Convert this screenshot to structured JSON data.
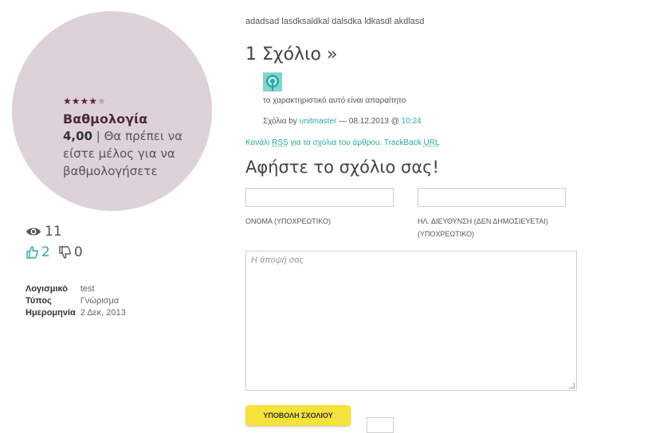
{
  "colors": {
    "accent": "#2aa8a0",
    "circle": "#ddd2d8",
    "button": "#f5e23a",
    "star": "#5e1f49"
  },
  "rating": {
    "stars_filled": 4,
    "stars_total": 5,
    "title": "Βαθμολογία",
    "value": "4,00",
    "note": "| Θα πρέπει να είστε μέλος για να βαθμολογήσετε"
  },
  "stats": {
    "views": "11",
    "likes": "2",
    "dislikes": "0"
  },
  "meta": [
    {
      "key": "Λογισμικό",
      "value": "test"
    },
    {
      "key": "Τύπος",
      "value": "Γνώρισμα"
    },
    {
      "key": "Ημερομηνία",
      "value": "2 Δεκ, 2013"
    }
  ],
  "post": {
    "text": "adadsad lasdksaldkal dalsdka ldkasdl akdlasd"
  },
  "comments": {
    "title": "1 Σχόλιο »",
    "items": [
      {
        "body": "το χαρακτηριστικό αυτό είναι απαραίτητο",
        "prefix": "Σχόλια by",
        "author": "unitmaster",
        "date": "— 08.12.2013 @",
        "time": "10:24"
      }
    ],
    "feeds_prefix": "Κανάλι",
    "rss": "RSS",
    "feeds_mid": "για τα σχόλια του άρθρου. TrackBack",
    "url": "URL"
  },
  "reply": {
    "title": "Αφήστε το σχόλιο σας!",
    "name_label": "ΟΝΟΜΑ (ΥΠΟΧΡΕΩΤΙΚΟ)",
    "email_label_1": "ΗΛ. ΔΙΕΥΘΥΝΣΗ (ΔΕΝ ΔΗΜΟΣΙΕΥΕΤΑΙ)",
    "email_label_2": "(ΥΠΟΧΡΕΩΤΙΚΟ)",
    "placeholder": "Η άποψή σας",
    "submit": "ΥΠΟΒΟΛΗ ΣΧΟΛΙΟΥ"
  }
}
